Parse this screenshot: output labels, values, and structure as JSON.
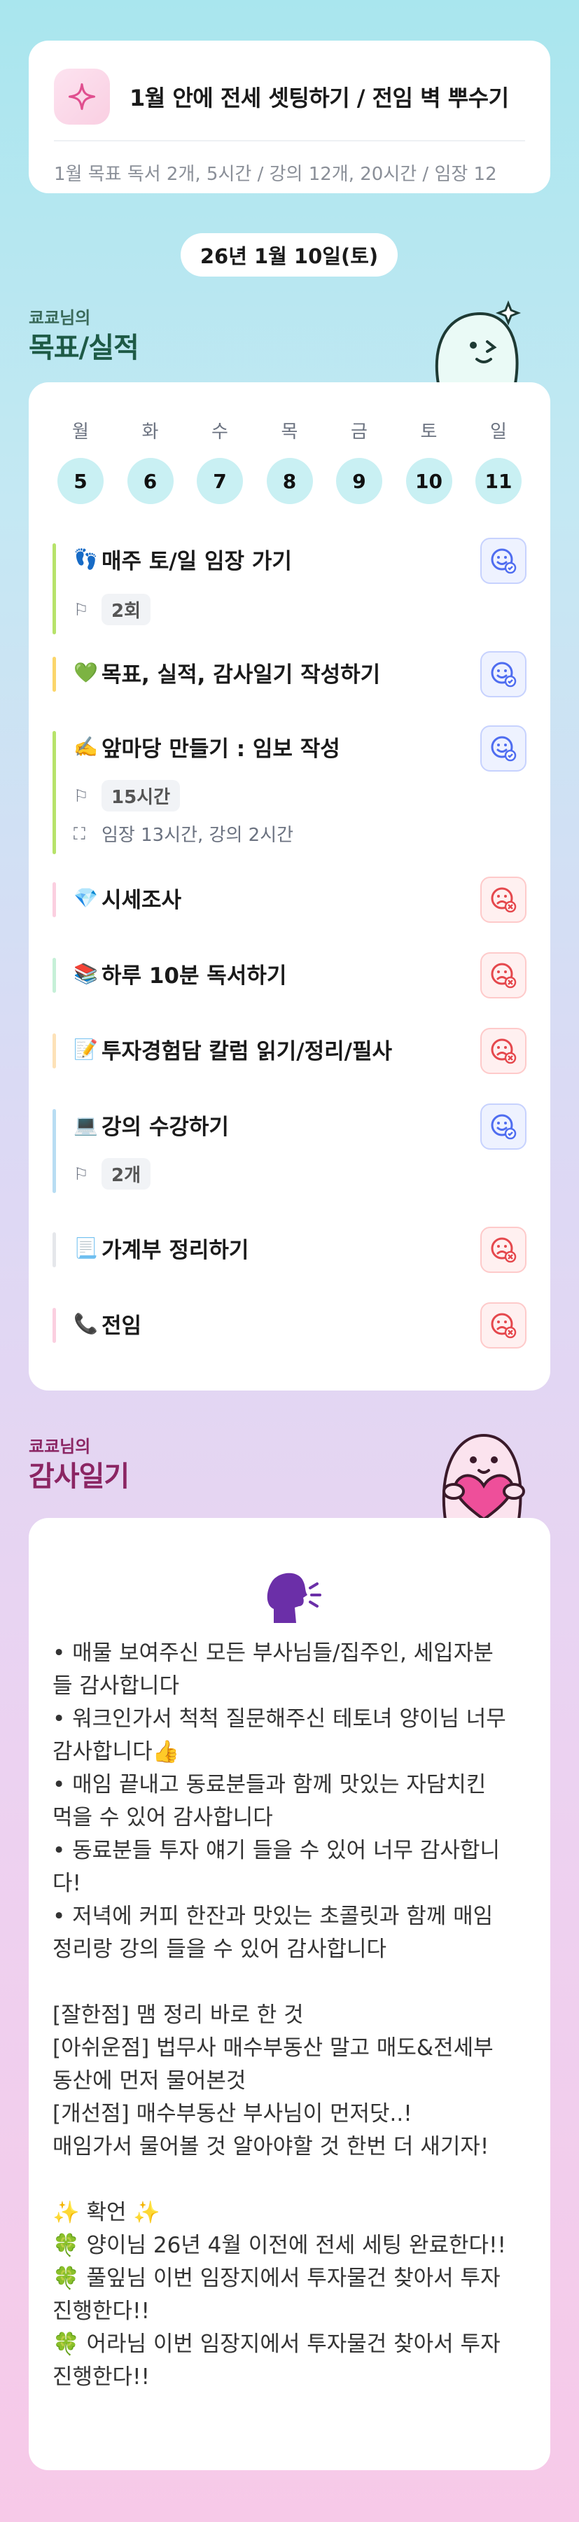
{
  "goal": {
    "icon": "sparkle-icon",
    "title": "1월 안에 전세 셋팅하기 / 전임 벽 뿌수기",
    "subtitle": "1월 목표  독서 2개, 5시간 / 강의 12개, 20시간 / 임장 12"
  },
  "date": "26년 1월 10일(토)",
  "goals_section": {
    "owner": "쿄쿄님의",
    "title": "목표/실적"
  },
  "week": [
    {
      "label": "월",
      "num": "5"
    },
    {
      "label": "화",
      "num": "6"
    },
    {
      "label": "수",
      "num": "7"
    },
    {
      "label": "목",
      "num": "8"
    },
    {
      "label": "금",
      "num": "9"
    },
    {
      "label": "토",
      "num": "10"
    },
    {
      "label": "일",
      "num": "11"
    }
  ],
  "tasks": [
    {
      "emoji": "👣",
      "title": "매주 토/일 임장 가기",
      "color": "#b7e36a",
      "status": "done",
      "chip": "2회"
    },
    {
      "emoji": "💚",
      "title": "목표, 실적, 감사일기 작성하기",
      "color": "#fbd66b",
      "status": "done"
    },
    {
      "emoji": "✍️",
      "title": "앞마당 만들기 : 임보 작성",
      "color": "#b7e36a",
      "status": "done",
      "chip": "15시간",
      "detail": "임장 13시간, 강의 2시간"
    },
    {
      "emoji": "💎",
      "title": "시세조사",
      "color": "#fbcfe0",
      "status": "fail"
    },
    {
      "emoji": "📚",
      "title": "하루 10분 독서하기",
      "color": "#c6f0d8",
      "status": "fail"
    },
    {
      "emoji": "📝",
      "title": "투자경험담 칼럼 읽기/정리/필사",
      "color": "#fde2b8",
      "status": "fail"
    },
    {
      "emoji": "💻",
      "title": "강의 수강하기",
      "color": "#b8ddf3",
      "status": "done",
      "chip": "2개"
    },
    {
      "emoji": "📃",
      "title": "가계부 정리하기",
      "color": "#e5e7eb",
      "status": "fail"
    },
    {
      "emoji": "📞",
      "title": "전임",
      "color": "#fbcfe0",
      "status": "fail"
    }
  ],
  "thanks_section": {
    "owner": "쿄쿄님의",
    "title": "감사일기"
  },
  "thanks_lines": [
    "• 매물 보여주신 모든 부사님들/집주인, 세입자분",
    "들 감사합니다",
    "• 워크인가서 척척 질문해주신 테토녀 양이님 너무",
    "감사합니다👍",
    "• 매임 끝내고 동료분들과 함께 맛있는 자담치킨",
    "먹을 수 있어 감사합니다",
    "• 동료분들 투자 얘기 들을 수 있어 너무 감사합니",
    "다!",
    "• 저녁에 커피 한잔과 맛있는 초콜릿과 함께 매임",
    "정리랑 강의 들을 수 있어 감사합니다",
    "",
    "[잘한점] 맴 정리 바로 한 것",
    "[아쉬운점] 법무사 매수부동산 말고 매도&전세부",
    "동산에 먼저 물어본것",
    "[개선점] 매수부동산 부사님이 먼저닷..!",
    "매임가서 물어볼 것 알아야할 것 한번 더 새기자!",
    "",
    "✨ 확언 ✨",
    "🍀 양이님 26년 4월 이전에 전세 세팅 완료한다!!",
    "🍀 풀잎님 이번 임장지에서 투자물건 찾아서 투자",
    "진행한다!!",
    "🍀 어라님 이번 임장지에서 투자물건 찾아서 투자",
    "진행한다!!"
  ]
}
